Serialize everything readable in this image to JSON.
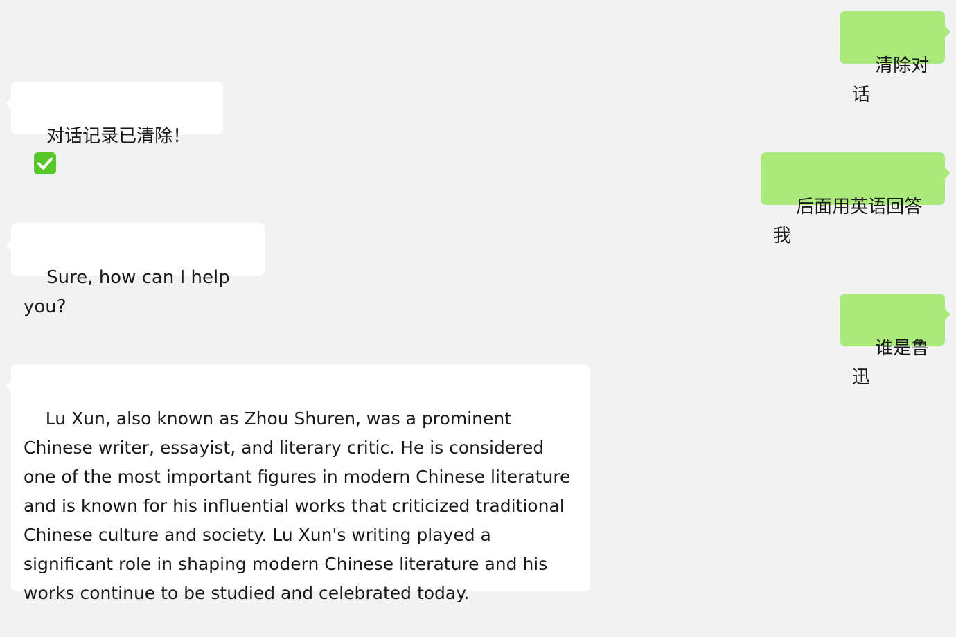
{
  "chat": {
    "messages": [
      {
        "role": "user",
        "text": "清除对话"
      },
      {
        "role": "assistant",
        "text": "对话记录已清除！",
        "icon": "check-mark-button-icon",
        "icon_color": "#55c72b"
      },
      {
        "role": "user",
        "text": "后面用英语回答我"
      },
      {
        "role": "assistant",
        "text": "Sure, how can I help you?"
      },
      {
        "role": "user",
        "text": "谁是鲁迅"
      },
      {
        "role": "assistant",
        "text": "Lu Xun, also known as Zhou Shuren, was a prominent Chinese writer, essayist, and literary critic. He is considered one of the most important figures in modern Chinese literature and is known for his influential works that criticized traditional Chinese culture and society. Lu Xun's writing played a significant role in shaping modern Chinese literature and his works continue to be studied and celebrated today."
      }
    ],
    "colors": {
      "background": "#f2f2f2",
      "user_bubble": "#a9ea7a",
      "assistant_bubble": "#ffffff",
      "text": "#191919"
    }
  }
}
